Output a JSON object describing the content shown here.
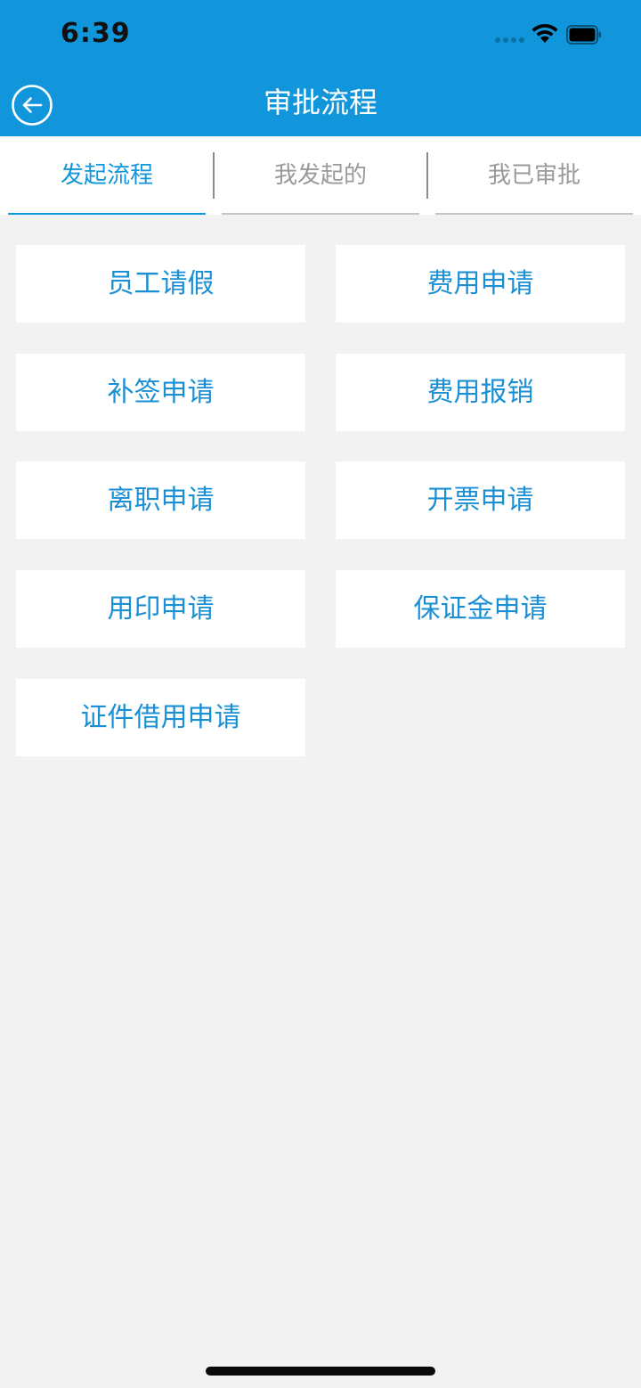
{
  "status_bar": {
    "time": "6:39"
  },
  "header": {
    "title": "审批流程",
    "back_icon": "back-arrow-circle-icon"
  },
  "tabs": [
    {
      "label": "发起流程",
      "active": true
    },
    {
      "label": "我发起的",
      "active": false
    },
    {
      "label": "我已审批",
      "active": false
    }
  ],
  "flows": [
    {
      "label": "员工请假"
    },
    {
      "label": "费用申请"
    },
    {
      "label": "补签申请"
    },
    {
      "label": "费用报销"
    },
    {
      "label": "离职申请"
    },
    {
      "label": "开票申请"
    },
    {
      "label": "用印申请"
    },
    {
      "label": "保证金申请"
    },
    {
      "label": "证件借用申请"
    }
  ],
  "colors": {
    "header_bg": "#1296db",
    "accent": "#1296db",
    "item_text": "#1a8fd3",
    "inactive_tab": "#9a9a9a",
    "page_bg": "#f2f2f2"
  }
}
